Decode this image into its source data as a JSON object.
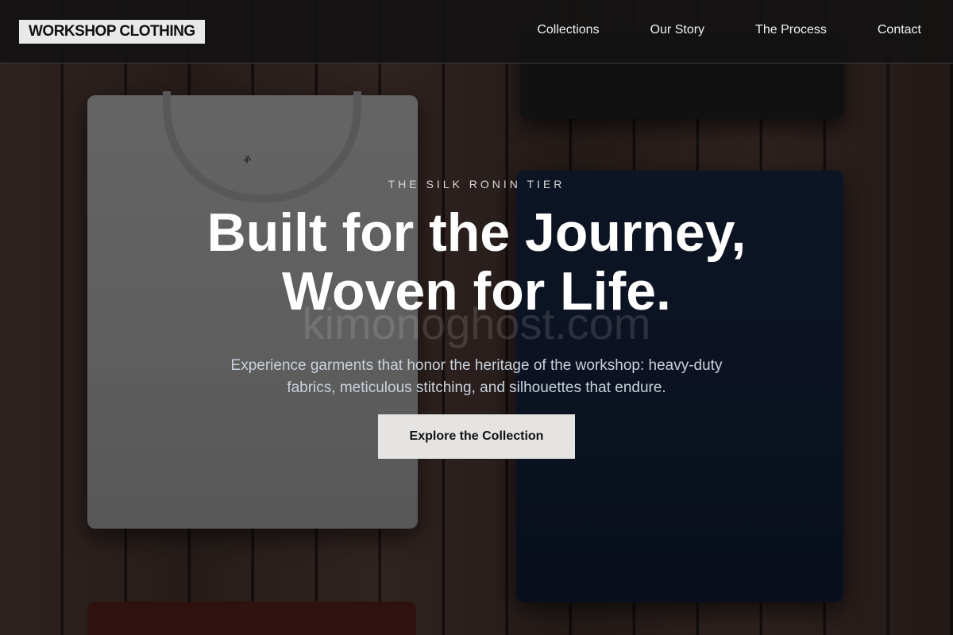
{
  "nav": {
    "logo": "WORKSHOP CLOTHING",
    "links": [
      "Collections",
      "Our Story",
      "The Process",
      "Contact"
    ]
  },
  "hero": {
    "eyebrow": "THE SILK RONIN TIER",
    "headline_line1": "Built for the Journey,",
    "headline_line2": "Woven for Life.",
    "watermark": "kimonoghost.com",
    "subtext": "Experience garments that honor the heritage of the workshop: heavy-duty fabrics, meticulous stitching, and silhouettes that endure.",
    "cta_label": "Explore the Collection",
    "shirt_tag_glyph": "ቆ"
  },
  "colors": {
    "nav_bg": "#141212",
    "logo_bg": "#e9e9e9",
    "cta_bg": "#e6e4e2",
    "subtext": "#c9d1dc"
  }
}
